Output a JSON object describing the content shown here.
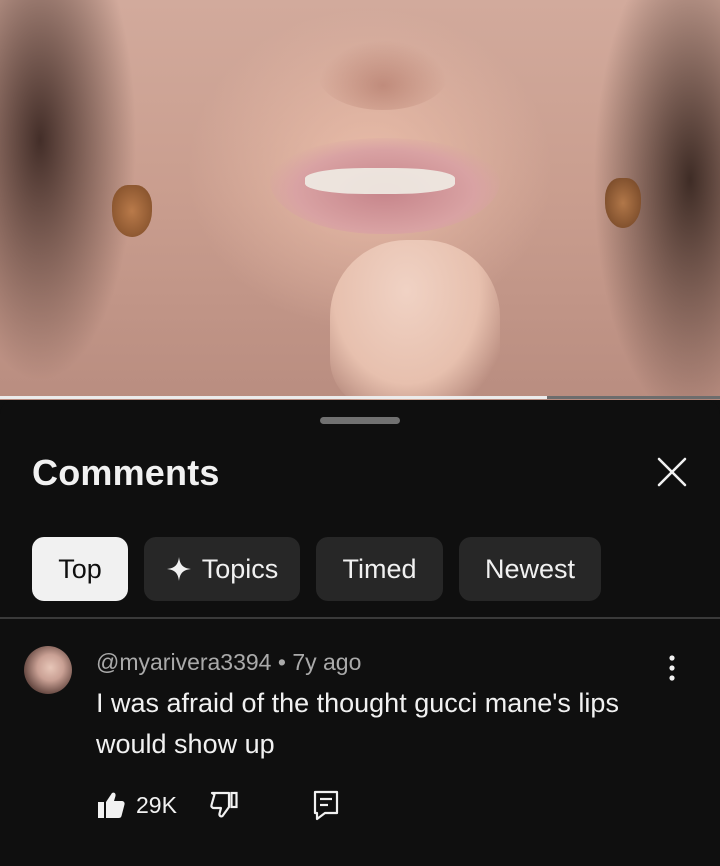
{
  "video": {
    "progress_fraction": 0.76
  },
  "comments_panel": {
    "title": "Comments",
    "close_icon": "close-icon",
    "chips": [
      {
        "label": "Top",
        "active": true
      },
      {
        "label": "Topics",
        "icon": "sparkle-icon",
        "active": false
      },
      {
        "label": "Timed",
        "active": false
      },
      {
        "label": "Newest",
        "active": false
      }
    ]
  },
  "comment": {
    "author": "@myarivera3394",
    "age": "7y ago",
    "meta_separator": " • ",
    "text": "I was afraid of the thought gucci mane's lips would show up",
    "likes": "29K",
    "icons": {
      "like": "thumbs-up-icon",
      "dislike": "thumbs-down-icon",
      "reply": "reply-icon",
      "menu": "more-vertical-icon"
    }
  },
  "colors": {
    "background": "#0f0f0f",
    "chip": "#272727",
    "chip_active": "#f1f1f1",
    "text_primary": "#f1f1f1",
    "text_secondary": "#aaaaaa"
  }
}
